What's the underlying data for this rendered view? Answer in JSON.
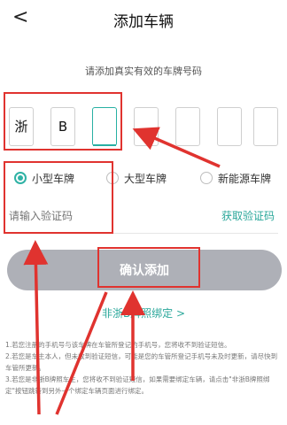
{
  "header": {
    "back_icon": "back-arrow-icon",
    "back_glyph": "<",
    "title": "添加车辆"
  },
  "subtitle": "请添加真实有效的车牌号码",
  "plate": {
    "characters": [
      "浙",
      "B",
      "",
      "",
      "",
      "",
      "",
      ""
    ],
    "active_index": 2
  },
  "plate_types": {
    "selected": "小型车牌",
    "options": [
      "小型车牌",
      "大型车牌",
      "新能源车牌"
    ]
  },
  "verification": {
    "placeholder": "请输入验证码",
    "get_code_label": "获取验证码"
  },
  "confirm_button": {
    "label": "确认添加"
  },
  "nonlocal_link": {
    "label": "非浙B牌照绑定 >"
  },
  "notes": [
    "1.若您注册的手机号与该车牌在车管所登记的手机号，您将收不到验证短信。",
    "2.若您是车主本人，但未收到验证短信，可能是您的车管所登记手机号未及时更新，请尽快到车管所更新。",
    "3.若您是非浙B牌照车主，您将收不到验证短信，如果需要绑定车辆，请点击\"非浙B牌照绑定\"按钮跳转到另外一个绑定车辆页面进行绑定。"
  ],
  "accent_color": "#2aa79a",
  "annotation_color": "#e0332f"
}
